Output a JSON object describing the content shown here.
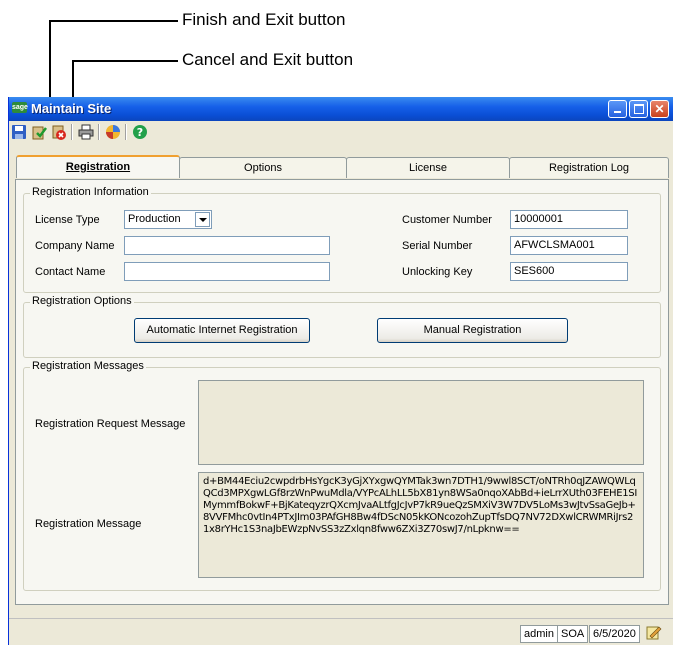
{
  "annotations": {
    "finish_exit": "Finish and Exit button",
    "cancel_exit": "Cancel and Exit button"
  },
  "window": {
    "title": "Maintain Site",
    "app_icon": "sage",
    "title_buttons": [
      "minimize-icon",
      "maximize-icon",
      "close-icon"
    ]
  },
  "toolbar": {
    "icons": [
      "save-icon",
      "finish-exit-icon",
      "cancel-exit-icon",
      "print-icon",
      "refresh-icon",
      "help-icon"
    ]
  },
  "tabs": [
    {
      "label": "Registration",
      "active": true
    },
    {
      "label": "Options",
      "active": false
    },
    {
      "label": "License",
      "active": false
    },
    {
      "label": "Registration Log",
      "active": false
    }
  ],
  "registration_info": {
    "title": "Registration Information",
    "license_type_label": "License Type",
    "license_type_value": "Production",
    "company_name_label": "Company Name",
    "company_name_value": "",
    "contact_name_label": "Contact Name",
    "contact_name_value": "",
    "customer_number_label": "Customer Number",
    "customer_number_value": "10000001",
    "serial_number_label": "Serial Number",
    "serial_number_value": "AFWCLSMA001",
    "unlocking_key_label": "Unlocking Key",
    "unlocking_key_value": "SES600"
  },
  "registration_options": {
    "title": "Registration Options",
    "automatic_label": "Automatic Internet Registration",
    "manual_label": "Manual Registration"
  },
  "registration_messages": {
    "title": "Registration Messages",
    "request_label": "Registration Request Message",
    "request_value": "",
    "message_label": "Registration Message",
    "message_value": "d+BM44Eciu2cwpdrbHsYgcK3yGjXYxgwQYMTak3wn7DTH1/9wwl8SCT/oNTRh0qJZAWQWLqQCd3MPXgwLGf8rzWnPwuMdla/VYPcALhLL5bX81yn8WSa0nqoXAbBd+ieLrrXUth03FEHE1SIMymmfBokwF+BjKateqyzrQXcmJvaALtfgJcJvP7kR9ueQzSMXiV3W7DV5LoMs3wJtvSsaGeJb+8VVFMhc0vtIn4PTxJIm03PAfGH8Bw4fDScN05kKONcozohZupTfsDQ7NV72DXwlCRWMRiJrs21x8rYHc1S3naJbEWzpNvSS3zZxlqn8fww6ZXi3Z70swJ7/nLpknw=="
  },
  "status": {
    "user": "admin",
    "company": "SOA",
    "date": "6/5/2020"
  }
}
